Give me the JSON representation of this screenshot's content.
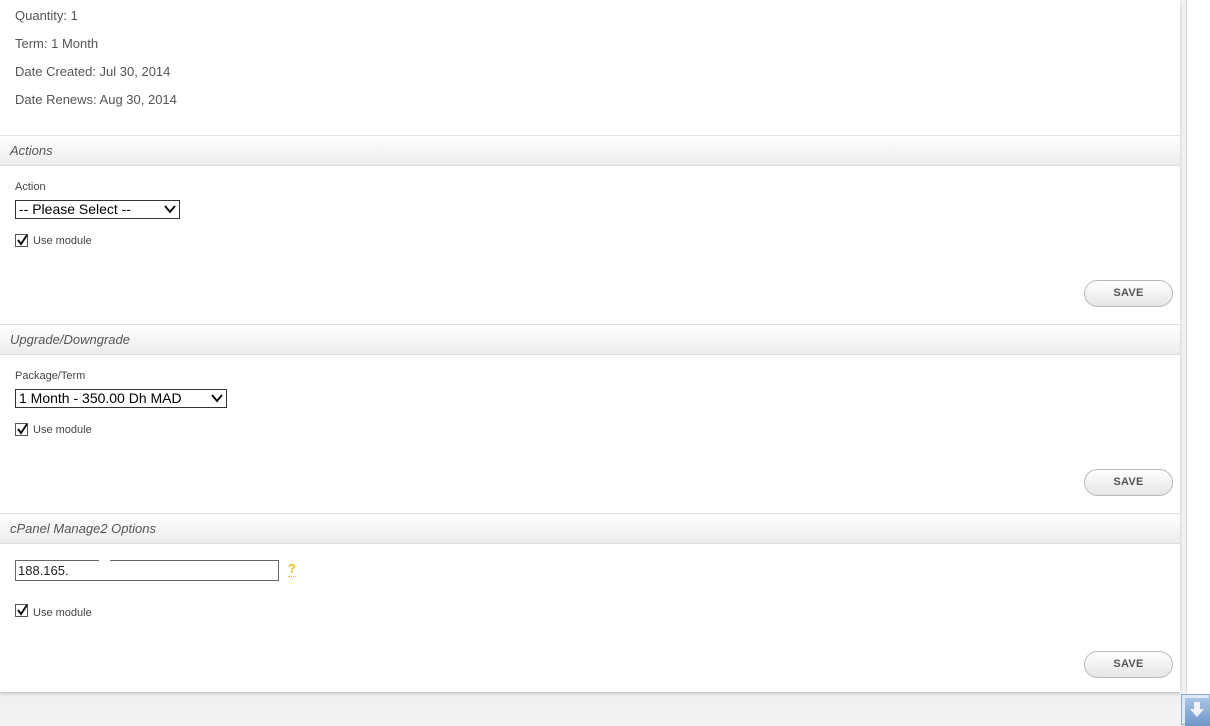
{
  "service_info": {
    "quantity": "Quantity: 1",
    "term": "Term: 1 Month",
    "date_created": "Date Created: Jul 30, 2014",
    "date_renews": "Date Renews: Aug 30, 2014"
  },
  "actions": {
    "title": "Actions",
    "field_label": "Action",
    "select_value": "-- Please Select --",
    "use_module_label": "Use module",
    "use_module_checked": true,
    "save_label": "SAVE"
  },
  "upgrade": {
    "title": "Upgrade/Downgrade",
    "field_label": "Package/Term",
    "select_value": "1 Month - 350.00 Dh MAD",
    "use_module_label": "Use module",
    "use_module_checked": true,
    "save_label": "SAVE"
  },
  "cpanel": {
    "title": "cPanel Manage2 Options",
    "ip_value": "188.165.",
    "help_symbol": "?",
    "use_module_label": "Use module",
    "use_module_checked": true,
    "save_label": "SAVE"
  },
  "icons": {
    "select_chevron": "chevron-down-icon",
    "checkbox_mark": "checkmark-icon",
    "help": "help-icon",
    "scroll_down": "arrow-down-icon"
  },
  "colors": {
    "help_accent": "#e0c31c",
    "scroll_button": "#6f96c7"
  }
}
